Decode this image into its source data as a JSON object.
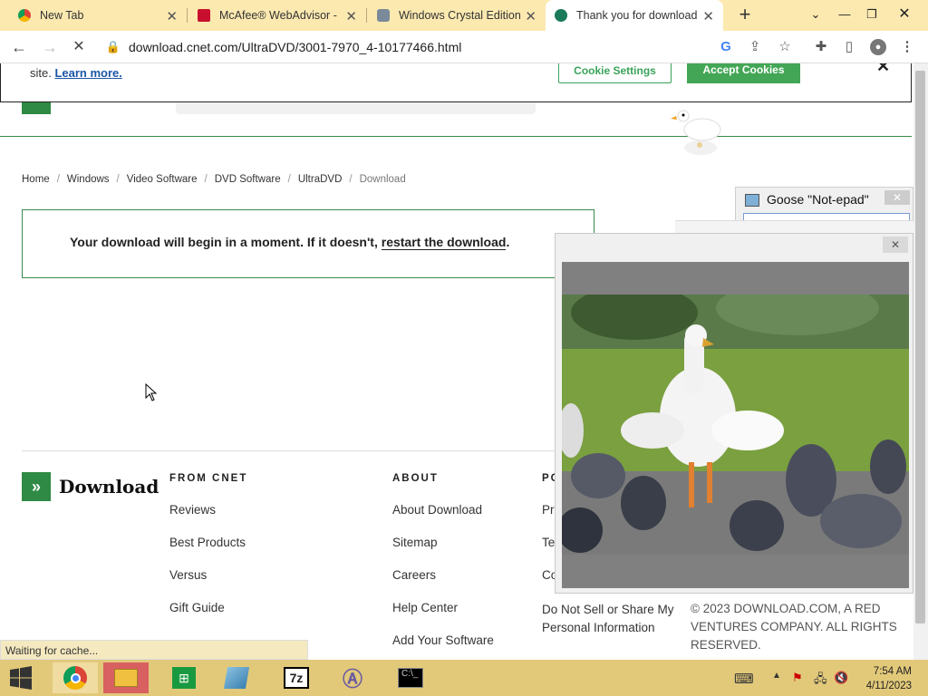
{
  "browser": {
    "tabs": [
      {
        "label": "New Tab",
        "active": false
      },
      {
        "label": "McAfee® WebAdvisor - ",
        "active": false
      },
      {
        "label": "Windows Crystal Edition",
        "active": false
      },
      {
        "label": "Thank you for download",
        "active": true
      }
    ],
    "url": "download.cnet.com/UltraDVD/3001-7970_4-10177466.html"
  },
  "cookie_banner": {
    "text": "site.",
    "learn_more": "Learn more.",
    "settings_label": "Cookie Settings",
    "accept_label": "Accept Cookies"
  },
  "breadcrumb": [
    "Home",
    "Windows",
    "Video Software",
    "DVD Software",
    "UltraDVD",
    "Download"
  ],
  "download_box": {
    "message": "Your download will begin in a moment. If it doesn't, ",
    "link": "restart the download",
    "end": "."
  },
  "footer": {
    "logo": "Download",
    "columns": [
      {
        "heading": "FROM CNET",
        "links": [
          "Reviews",
          "Best Products",
          "Versus",
          "Gift Guide"
        ]
      },
      {
        "heading": "ABOUT",
        "links": [
          "About Download",
          "Sitemap",
          "Careers",
          "Help Center",
          "Add Your Software"
        ]
      },
      {
        "heading": "PO",
        "links": [
          "Pr",
          "Te",
          "Co",
          "Do Not Sell or Share My Personal Information"
        ]
      }
    ],
    "copyright": "© 2023 DOWNLOAD.COM, A RED VENTURES COMPANY. ALL RIGHTS RESERVED."
  },
  "status_bar": "Waiting for cache...",
  "notepad_window": {
    "title": "Goose \"Not-epad\""
  },
  "taskbar": {
    "time": "7:54 AM",
    "date": "4/11/2023"
  }
}
